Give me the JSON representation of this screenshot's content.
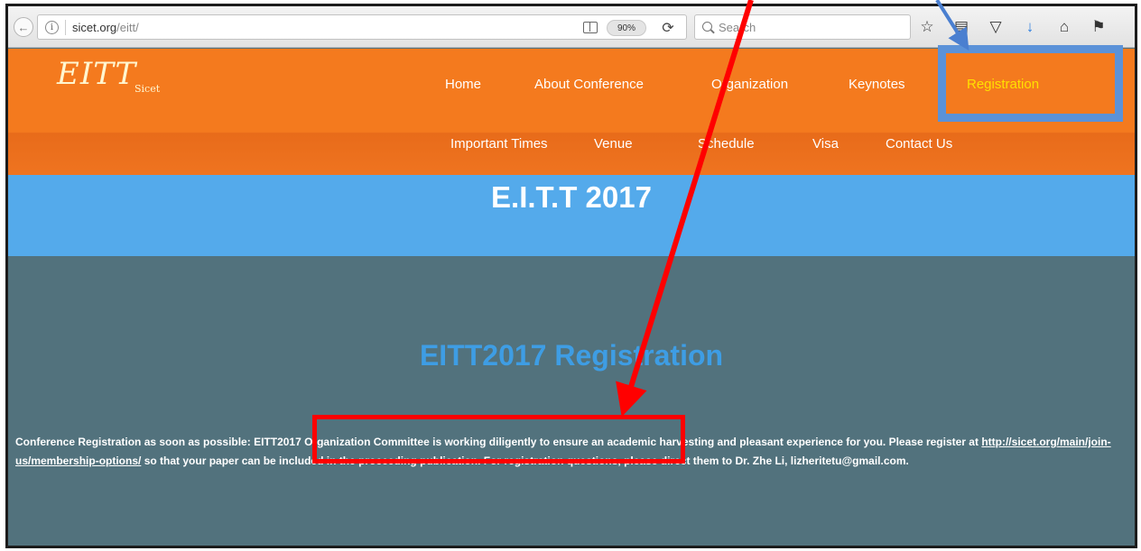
{
  "browser": {
    "url_host": "sicet.org",
    "url_path": "/eitt/",
    "zoom": "90%",
    "search_placeholder": "Search",
    "icons": [
      "back-arrow-icon",
      "info-icon",
      "reader-view-icon",
      "reload-icon",
      "search-icon",
      "star-icon",
      "reading-list-icon",
      "pocket-icon",
      "download-icon",
      "home-icon",
      "extension-icon"
    ]
  },
  "site": {
    "logo_main": "EITT",
    "logo_sub": "Sicet",
    "nav": {
      "home": "Home",
      "about": "About Conference",
      "organization": "Organization",
      "keynotes": "Keynotes",
      "registration": "Registration",
      "important_times": "Important Times",
      "venue": "Venue",
      "schedule": "Schedule",
      "visa": "Visa",
      "contact": "Contact Us"
    },
    "active_nav": "Registration"
  },
  "page": {
    "conference_title": "E.I.T.T 2017",
    "registration_heading": "EITT2017 Registration",
    "text_part1": "Conference Registration as soon as possible: EITT2017 Organization Committee is working diligently to ensure an academic harvesting and pleasant experience for you. Please register at ",
    "text_link": "http://sicet.org/main/join-us/membership-options/",
    "text_part2": " so that your paper can be included in the proceeding publication. For registration questions, please direct them to Dr. Zhe Li, lizheritetu@gmail.com."
  },
  "colors": {
    "nav_orange": "#f47a1e",
    "band_blue": "#54aaeb",
    "content_slate": "#52727d",
    "heading_blue": "#3e9de4",
    "active_yellow": "#ffe000",
    "annotation_red": "#ff0000",
    "annotation_blue": "#5b92d8"
  }
}
